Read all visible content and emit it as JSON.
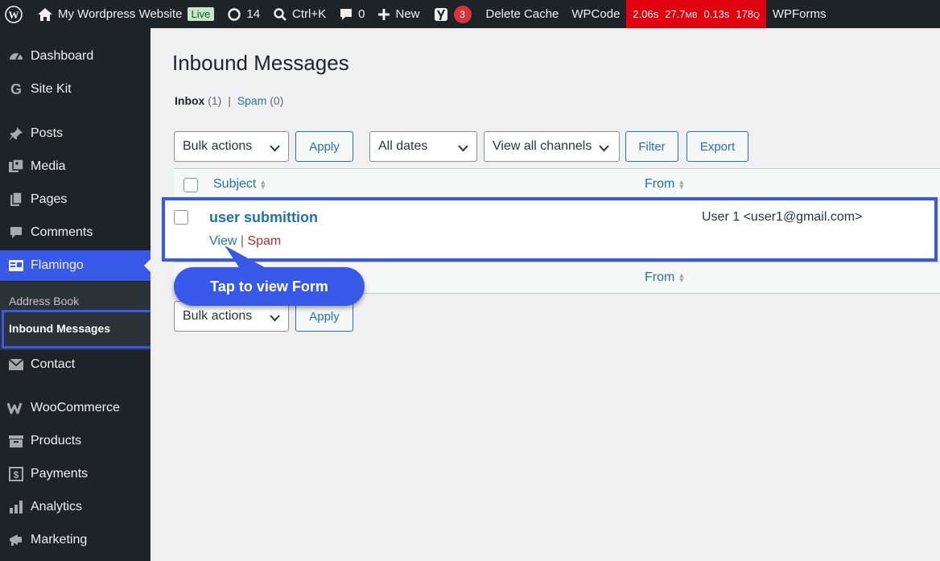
{
  "adminbar": {
    "site_name": "My Wordpress Website",
    "live_label": "Live",
    "updates_count": "14",
    "search_shortcut": "Ctrl+K",
    "comments_count": "0",
    "new_label": "New",
    "yoast_count": "3",
    "delete_cache": "Delete Cache",
    "wpcode": "WPCode",
    "perf": {
      "time": "2.06s",
      "memory": "27.7",
      "memory_unit": "MB",
      "query_time": "0.13s",
      "queries": "178",
      "queries_unit": "Q",
      "color": "#e0000e"
    },
    "wpforms": "WPForms"
  },
  "sidebar": {
    "items": [
      {
        "label": "Dashboard",
        "icon": "dashboard-icon"
      },
      {
        "label": "Site Kit",
        "icon": "google-g-icon"
      },
      {
        "label": "Posts",
        "icon": "pin-icon"
      },
      {
        "label": "Media",
        "icon": "media-icon"
      },
      {
        "label": "Pages",
        "icon": "pages-icon"
      },
      {
        "label": "Comments",
        "icon": "comment-icon"
      },
      {
        "label": "Flamingo",
        "icon": "flamingo-icon"
      },
      {
        "label": "Contact",
        "icon": "envelope-icon"
      },
      {
        "label": "WooCommerce",
        "icon": "woocommerce-icon"
      },
      {
        "label": "Products",
        "icon": "archive-icon"
      },
      {
        "label": "Payments",
        "icon": "dollar-icon"
      },
      {
        "label": "Analytics",
        "icon": "bar-chart-icon"
      },
      {
        "label": "Marketing",
        "icon": "megaphone-icon"
      }
    ],
    "submenu": {
      "address_book": "Address Book",
      "inbound_messages": "Inbound Messages"
    }
  },
  "main": {
    "title": "Inbound Messages",
    "views": {
      "inbox": "Inbox",
      "inbox_count": "(1)",
      "separator": "|",
      "spam": "Spam",
      "spam_count": "(0)"
    },
    "bulk_actions": "Bulk actions",
    "apply": "Apply",
    "all_dates": "All dates",
    "channels": "View all channels",
    "filter": "Filter",
    "export": "Export",
    "columns": {
      "subject": "Subject",
      "from": "From"
    },
    "rows": [
      {
        "subject": "user submittion",
        "from": "User 1 <user1@gmail.com>",
        "view": "View",
        "separator": "|",
        "spam": "Spam"
      }
    ],
    "callout": "Tap to view Form",
    "accent_color": "#3858e9"
  }
}
